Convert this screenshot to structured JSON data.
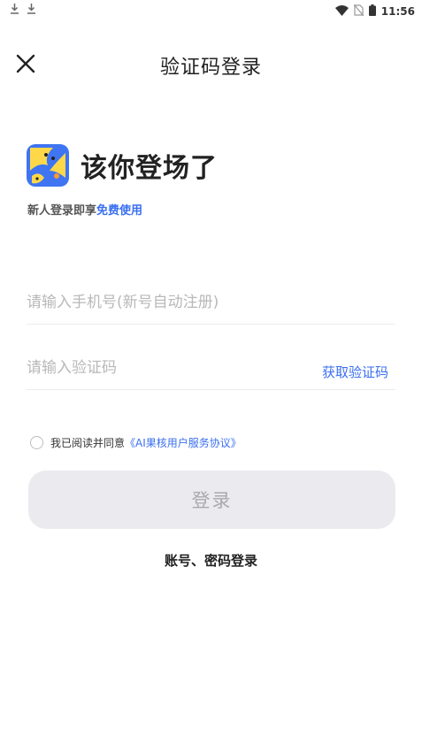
{
  "status_bar": {
    "time": "11:56",
    "icons": [
      "download-icon",
      "download-icon",
      "wifi-icon",
      "no-sim-icon",
      "battery-icon"
    ]
  },
  "header": {
    "title": "验证码登录",
    "close_icon": "close-icon"
  },
  "brand": {
    "heading": "该你登场了",
    "subtitle_prefix": "新人登录即享",
    "subtitle_highlight": "免费使用"
  },
  "form": {
    "phone_placeholder": "请输入手机号(新号自动注册)",
    "phone_value": "",
    "code_placeholder": "请输入验证码",
    "code_value": "",
    "get_code_label": "获取验证码"
  },
  "agreement": {
    "checked": false,
    "prefix": "我已阅读并同意",
    "link_text": "《AI果核用户服务协议》"
  },
  "login_button_label": "登录",
  "alt_login_label": "账号、密码登录",
  "colors": {
    "accent": "#3a6ff0",
    "logo_blue": "#3f74f2",
    "logo_yellow": "#ffd84a",
    "button_disabled_bg": "#ebebef",
    "button_disabled_text": "#a8a8ae"
  }
}
